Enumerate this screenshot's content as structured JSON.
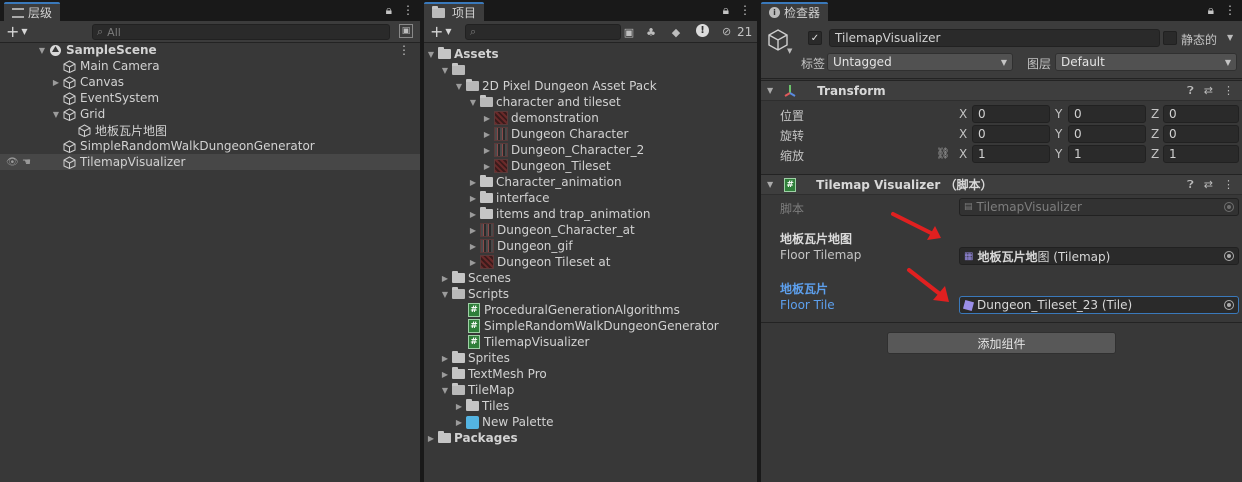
{
  "hierarchy": {
    "tab_label": "层级",
    "search_placeholder": "All",
    "scene": "SampleScene",
    "items": [
      {
        "label": "Main Camera"
      },
      {
        "label": "Canvas"
      },
      {
        "label": "EventSystem"
      },
      {
        "label": "Grid"
      },
      {
        "label": "地板瓦片地图"
      },
      {
        "label": "SimpleRandomWalkDungeonGenerator"
      },
      {
        "label": "TilemapVisualizer"
      }
    ]
  },
  "project": {
    "tab_label": "项目",
    "hidden_count": "21",
    "tree": [
      {
        "label": "Assets"
      },
      {
        "label": ""
      },
      {
        "label": "2D Pixel Dungeon Asset Pack"
      },
      {
        "label": "character and tileset"
      },
      {
        "label": "demonstration"
      },
      {
        "label": "Dungeon Character"
      },
      {
        "label": "Dungeon_Character_2"
      },
      {
        "label": "Dungeon_Tileset"
      },
      {
        "label": "Character_animation"
      },
      {
        "label": "interface"
      },
      {
        "label": "items and trap_animation"
      },
      {
        "label": "Dungeon_Character_at"
      },
      {
        "label": "Dungeon_gif"
      },
      {
        "label": "Dungeon Tileset at"
      },
      {
        "label": "Scenes"
      },
      {
        "label": "Scripts"
      },
      {
        "label": "ProceduralGenerationAlgorithms"
      },
      {
        "label": "SimpleRandomWalkDungeonGenerator"
      },
      {
        "label": "TilemapVisualizer"
      },
      {
        "label": "Sprites"
      },
      {
        "label": "TextMesh Pro"
      },
      {
        "label": "TileMap"
      },
      {
        "label": "Tiles"
      },
      {
        "label": "New Palette"
      },
      {
        "label": "Packages"
      }
    ]
  },
  "inspector": {
    "tab_label": "检查器",
    "object_name": "TilemapVisualizer",
    "static_label": "静态的",
    "tag_label": "标签",
    "tag_value": "Untagged",
    "layer_label": "图层",
    "layer_value": "Default",
    "transform": {
      "title": "Transform",
      "rows": [
        {
          "label": "位置",
          "x": "0",
          "y": "0",
          "z": "0"
        },
        {
          "label": "旋转",
          "x": "0",
          "y": "0",
          "z": "0"
        },
        {
          "label": "缩放",
          "x": "1",
          "y": "1",
          "z": "1"
        }
      ],
      "axis_x": "X",
      "axis_y": "Y",
      "axis_z": "Z"
    },
    "visualizer": {
      "title": "Tilemap Visualizer （脚本）",
      "script_label": "脚本",
      "script_value": "TilemapVisualizer",
      "floor_tilemap_header": "地板瓦片地图",
      "floor_tilemap_label": "Floor Tilemap",
      "floor_tilemap_value_bold": "地板瓦片地",
      "floor_tilemap_value_rest": "图 (Tilemap)",
      "floor_tile_header": "地板瓦片",
      "floor_tile_label": "Floor Tile",
      "floor_tile_value": "Dungeon_Tileset_23 (Tile)"
    },
    "add_component": "添加组件"
  },
  "colors": {
    "accent_blue": "#3a79bb",
    "annotation_red": "#e02020",
    "script_green": "#2f7f3a",
    "prefab_blue": "#54b4e2"
  }
}
